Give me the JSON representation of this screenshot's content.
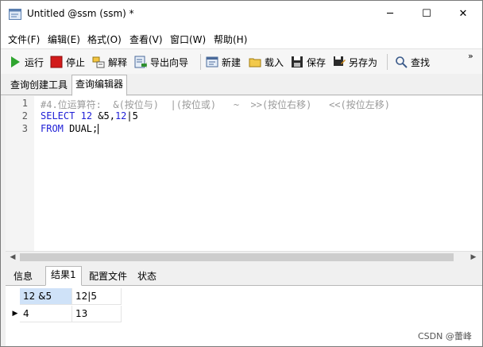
{
  "window": {
    "title": "Untitled @ssm (ssm) *",
    "min_symbol": "─",
    "max_symbol": "☐",
    "close_symbol": "✕"
  },
  "menubar": {
    "items": [
      "文件(F)",
      "编辑(E)",
      "格式(O)",
      "查看(V)",
      "窗口(W)",
      "帮助(H)"
    ]
  },
  "toolbar": {
    "run": "运行",
    "stop": "停止",
    "explain": "解释",
    "export_wizard": "导出向导",
    "new": "新建",
    "load": "载入",
    "save": "保存",
    "save_as": "另存为",
    "find": "查找",
    "overflow": "»"
  },
  "tabs": {
    "query_builder": "查询创建工具",
    "query_editor": "查询编辑器"
  },
  "editor": {
    "line_numbers": [
      "1",
      "2",
      "3"
    ],
    "line1_comment": "#4.位运算符:  &(按位与)  |(按位或)   ~  >>(按位右移)   <<(按位左移)",
    "line2_kw": "SELECT",
    "line2_num1": "12",
    "line2_rest1": " &5,",
    "line2_num2": "12",
    "line2_rest2": "|5",
    "line3_kw1": "FROM",
    "line3_rest": " DUAL;"
  },
  "result_tabs": {
    "info": "信息",
    "result1": "结果1",
    "profile": "配置文件",
    "status": "状态"
  },
  "result": {
    "columns": [
      "12 &5",
      "12|5"
    ],
    "rows": [
      [
        "4",
        "13"
      ]
    ]
  },
  "watermark": "CSDN @蕾峰",
  "colors": {
    "keyword": "#1f1fd6",
    "comment": "#9a9a9a",
    "selection": "#cfe2f8"
  }
}
